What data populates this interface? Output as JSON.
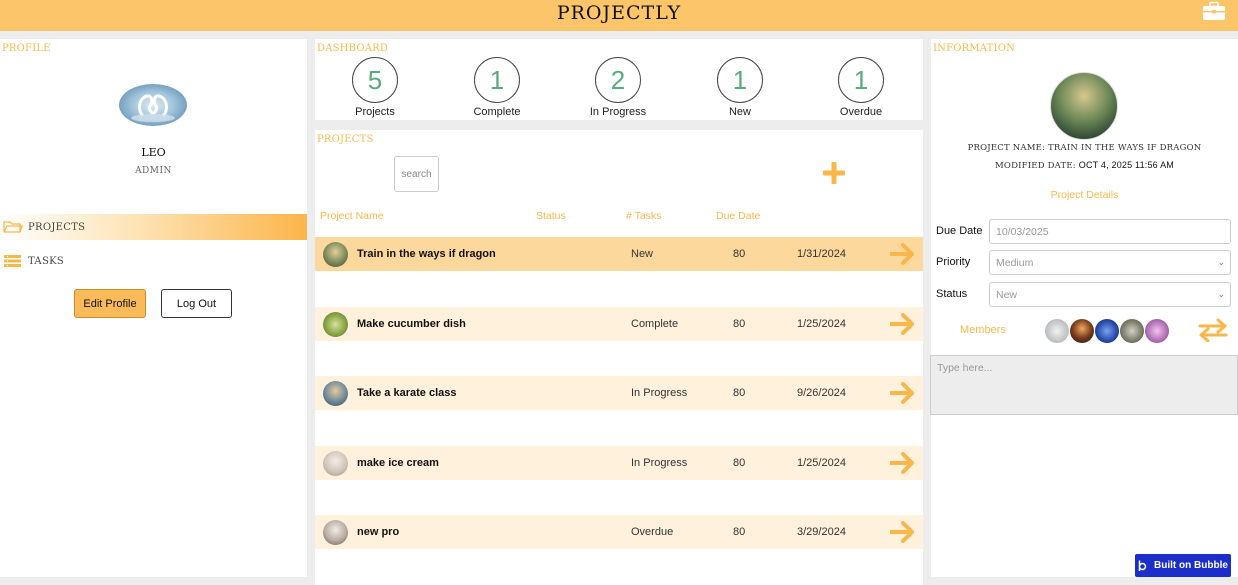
{
  "header": {
    "title": "PROJECTLY",
    "icon": "briefcase-icon"
  },
  "profile": {
    "section_title": "PROFILE",
    "name": "LEO",
    "role": "ADMIN",
    "nav": [
      {
        "label": "PROJECTS",
        "icon": "folder-icon",
        "active": true
      },
      {
        "label": "TASKS",
        "icon": "list-icon",
        "active": false
      }
    ],
    "edit_label": "Edit Profile",
    "logout_label": "Log Out"
  },
  "dashboard": {
    "section_title": "DASHBOARD",
    "stats": [
      {
        "value": "5",
        "label": "Projects"
      },
      {
        "value": "1",
        "label": "Complete"
      },
      {
        "value": "2",
        "label": "In Progress"
      },
      {
        "value": "1",
        "label": "New"
      },
      {
        "value": "1",
        "label": "Overdue"
      }
    ]
  },
  "projects": {
    "section_title": "PROJECTS",
    "search_placeholder": "search",
    "columns": [
      "Project Name",
      "Status",
      "# Tasks",
      "Due Date"
    ],
    "rows": [
      {
        "name": "Train in the ways if dragon",
        "status": "New",
        "tasks": "80",
        "due": "1/31/2024",
        "selected": true
      },
      {
        "name": "Make cucumber dish",
        "status": "Complete",
        "tasks": "80",
        "due": "1/25/2024",
        "selected": false
      },
      {
        "name": "Take a karate class",
        "status": "In Progress",
        "tasks": "80",
        "due": "9/26/2024",
        "selected": false
      },
      {
        "name": "make ice cream",
        "status": "In Progress",
        "tasks": "80",
        "due": "1/25/2024",
        "selected": false
      },
      {
        "name": "new pro",
        "status": "Overdue",
        "tasks": "80",
        "due": "3/29/2024",
        "selected": false
      }
    ]
  },
  "information": {
    "section_title": "INFORMATION",
    "project_name_label": "PROJECT NAME:",
    "project_name": "TRAIN IN THE WAYS IF DRAGON",
    "modified_label": "MODIFIED DATE:",
    "modified_date": "OCT 4, 2025 11:56 AM",
    "details_link": "Project Details",
    "due_date_label": "Due Date",
    "due_date_value": "10/03/2025",
    "priority_label": "Priority",
    "priority_value": "Medium",
    "status_label": "Status",
    "status_value": "New",
    "members_label": "Members",
    "notes_placeholder": "Type here..."
  },
  "badge": {
    "label": "Built on Bubble"
  },
  "colors": {
    "accent": "#fcc56a",
    "arrow": "#f9b649",
    "stat_number": "#5aaa7f"
  }
}
